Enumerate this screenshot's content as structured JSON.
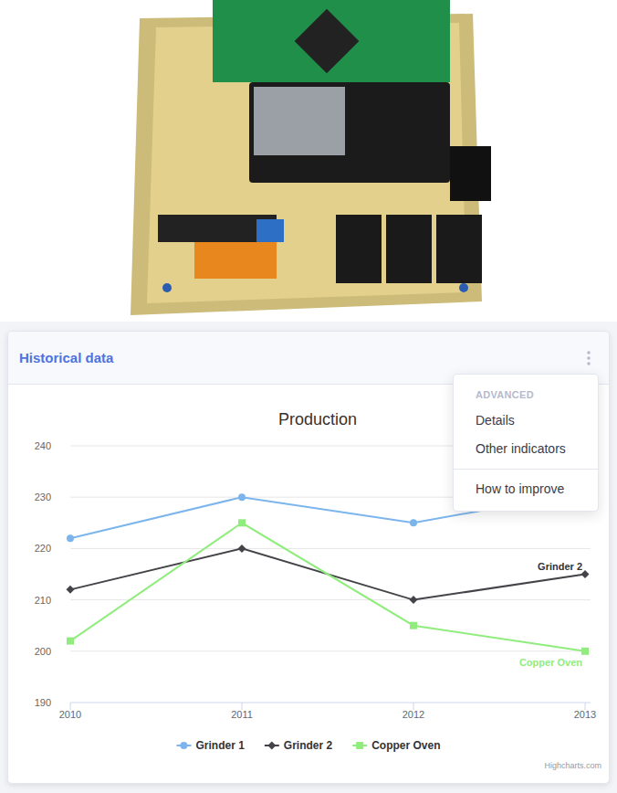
{
  "card": {
    "title": "Historical data"
  },
  "menu": {
    "expanded": true,
    "header": "ADVANCED",
    "items": [
      {
        "label": "Details",
        "divider_before": false
      },
      {
        "label": "Other indicators",
        "divider_before": false
      },
      {
        "label": "How to improve",
        "divider_before": true
      }
    ]
  },
  "chart": {
    "title": "Production",
    "y_ticks": [
      "240",
      "230",
      "220",
      "210",
      "200",
      "190"
    ],
    "x_categories": [
      "2010",
      "2011",
      "2012",
      "2013"
    ],
    "series": [
      {
        "name": "Grinder 1",
        "values": [
          222,
          230,
          225,
          231
        ],
        "color": "#7cb5ec",
        "kind": "circle",
        "end_label_shown": false
      },
      {
        "name": "Grinder 2",
        "values": [
          212,
          220,
          210,
          215
        ],
        "color": "#434348",
        "kind": "diamond",
        "end_label_shown": true
      },
      {
        "name": "Copper Oven",
        "values": [
          202,
          225,
          205,
          200
        ],
        "color": "#90ed7d",
        "kind": "square",
        "end_label_shown": true
      }
    ],
    "credits": "Highcharts.com"
  }
}
